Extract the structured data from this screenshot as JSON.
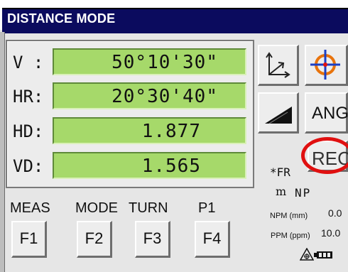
{
  "window": {
    "title": "DISTANCE MODE"
  },
  "measurements": [
    {
      "label": "V :",
      "value": "50°10'30\""
    },
    {
      "label": "HR:",
      "value": "20°30'40\""
    },
    {
      "label": "HD:",
      "value": "1.877"
    },
    {
      "label": "VD:",
      "value": "1.565"
    }
  ],
  "side_buttons": {
    "coordinate_icon": "coordinate-axes-icon",
    "target_icon": "crosshair-target-icon",
    "slope_icon": "slope-icon",
    "ang_label": "ANG",
    "rec_label": "REC"
  },
  "status": {
    "fr": "*FR",
    "unit": "m",
    "np": "NP",
    "npm_label": "NPM (mm)",
    "npm_value": "0.0",
    "ppm_label": "PPM (ppm)",
    "ppm_value": "10.0",
    "prism_icon": "prism-icon",
    "battery_icon": "battery-icon"
  },
  "function_keys": [
    {
      "label": "MEAS",
      "key": "F1"
    },
    {
      "label": "MODE",
      "key": "F2"
    },
    {
      "label": "TURN",
      "key": "F3"
    },
    {
      "label": "P1",
      "key": "F4"
    }
  ],
  "colors": {
    "value_bg": "#a6d96a",
    "title_bg": "#0b0b5e",
    "highlight": "#e01010"
  }
}
